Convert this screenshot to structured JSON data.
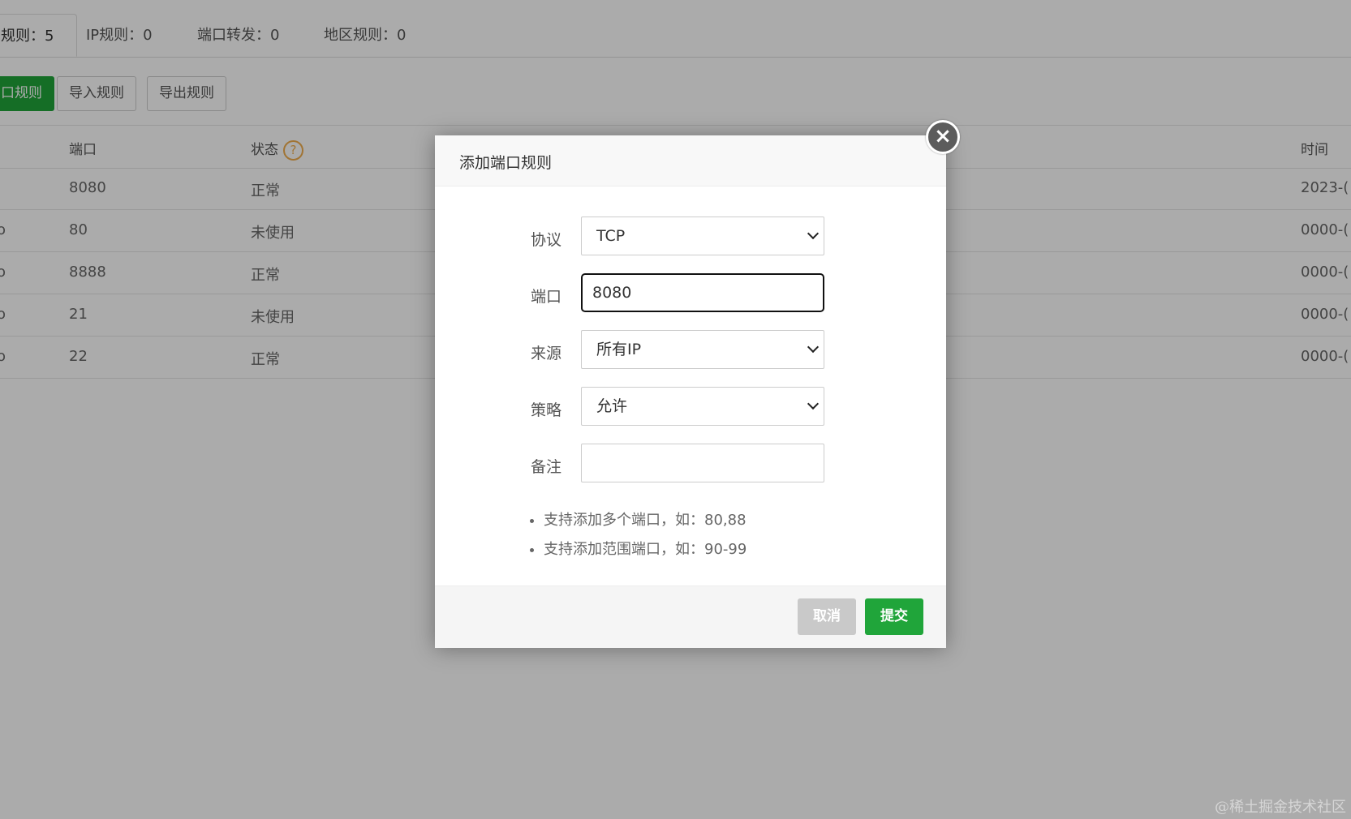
{
  "tabs": [
    {
      "label": "规则：5"
    },
    {
      "label": "IP规则：0"
    },
    {
      "label": "端口转发：0"
    },
    {
      "label": "地区规则：0"
    }
  ],
  "toolbar": {
    "add_label": "口规则",
    "import_label": "导入规则",
    "export_label": "导出规则"
  },
  "table": {
    "headers": {
      "port": "端口",
      "status": "状态",
      "help": "?",
      "time": "时间"
    },
    "rows": [
      {
        "left": "",
        "port": "8080",
        "status": "正常",
        "time": "2023-("
      },
      {
        "left": "o",
        "port": "80",
        "status": "未使用",
        "time": "0000-("
      },
      {
        "left": "o",
        "port": "8888",
        "status": "正常",
        "time": "0000-("
      },
      {
        "left": "o",
        "port": "21",
        "status": "未使用",
        "time": "0000-("
      },
      {
        "left": "o",
        "port": "22",
        "status": "正常",
        "time": "0000-("
      }
    ]
  },
  "modal": {
    "title": "添加端口规则",
    "close": "×",
    "fields": {
      "protocol": {
        "label": "协议",
        "value": "TCP"
      },
      "port": {
        "label": "端口",
        "value": "8080"
      },
      "source": {
        "label": "来源",
        "value": "所有IP"
      },
      "strategy": {
        "label": "策略",
        "value": "允许"
      },
      "remark": {
        "label": "备注",
        "value": ""
      }
    },
    "tips": [
      "支持添加多个端口，如：80,88",
      "支持添加范围端口，如：90-99"
    ],
    "cancel_label": "取消",
    "submit_label": "提交"
  },
  "watermark": "@稀土掘金技术社区",
  "colors": {
    "accent": "#20a53a",
    "help": "#f0ad4e",
    "overlay": "rgba(0,0,0,0.33)"
  }
}
